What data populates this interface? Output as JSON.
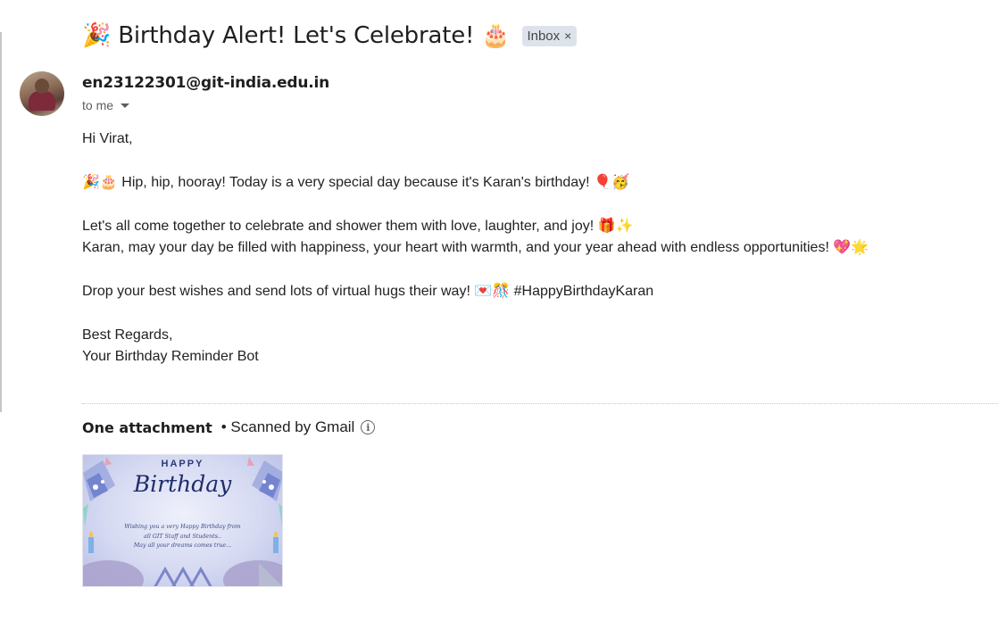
{
  "email": {
    "subject": "🎉 Birthday Alert! Let's Celebrate! 🎂",
    "label_chip": "Inbox",
    "label_chip_close": "×",
    "sender": "en23122301@git-india.edu.in",
    "recipient_summary": "to me",
    "body_paragraphs": [
      [
        "Hi Virat,"
      ],
      [
        "🎉🎂 Hip, hip, hooray! Today is a very special day because it's Karan's birthday! 🎈🥳"
      ],
      [
        "Let's all come together to celebrate and shower them with love, laughter, and joy! 🎁✨",
        "Karan, may your day be filled with happiness, your heart with warmth, and your year ahead with endless opportunities! 💖🌟"
      ],
      [
        "Drop your best wishes and send lots of virtual hugs their way! 💌🎊 #HappyBirthdayKaran"
      ],
      [
        "Best Regards,",
        "Your Birthday Reminder Bot"
      ]
    ]
  },
  "attachments": {
    "title": "One attachment",
    "scan_note": "• Scanned by Gmail",
    "info_icon": "info-icon",
    "items": [
      {
        "heading_small": "HAPPY",
        "heading_large": "Birthday",
        "wish_lines": [
          "Wishing you a very Happy Birthday from",
          "all GIT Staff and Students..",
          "May all your dreams comes true..."
        ]
      }
    ]
  },
  "colors": {
    "chip_bg": "#dde3ea",
    "text_primary": "#1f1f1f",
    "text_secondary": "#5e5e5e",
    "card_accent": "#1f2d6b"
  }
}
